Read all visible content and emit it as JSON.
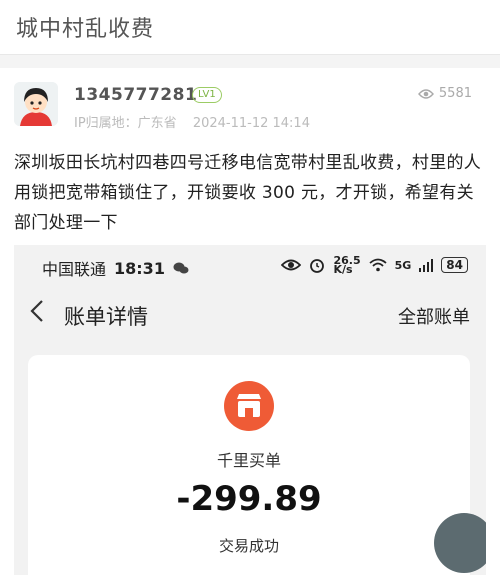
{
  "header": {
    "title": "城中村乱收费"
  },
  "post": {
    "username": "1345777281",
    "level": "LV1",
    "ip_label": "IP归属地：广东省",
    "datetime": "2024-11-12 14:14",
    "views": "5581",
    "body": "深圳坂田长坑村四巷四号迁移电信宽带村里乱收费，村里的人用锁把宽带箱锁住了，开锁要收 300 元，才开锁，希望有关部门处理一下"
  },
  "screenshot": {
    "status": {
      "carrier": "中国联通",
      "time": "18:31",
      "speed_top": "26.5",
      "speed_unit": "K/s",
      "network": "5G",
      "battery": "84"
    },
    "nav": {
      "title": "账单详情",
      "action": "全部账单"
    },
    "bill": {
      "merchant": "千里买单",
      "amount": "-299.89",
      "status": "交易成功"
    }
  },
  "colors": {
    "accent": "#ef5b36",
    "level_badge": "#9ccc65"
  }
}
